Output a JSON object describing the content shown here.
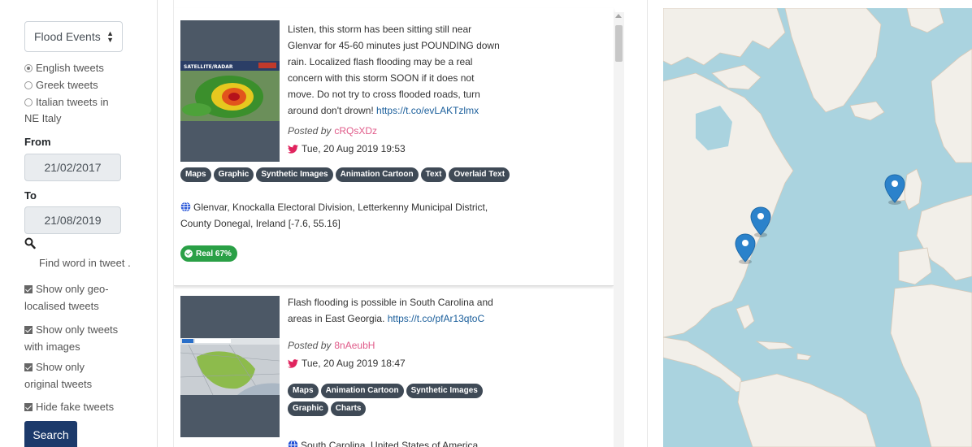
{
  "sidebar": {
    "event_select": "Flood Events",
    "languages": [
      {
        "label": "English tweets",
        "selected": true
      },
      {
        "label": "Greek tweets",
        "selected": false
      },
      {
        "label": "Italian tweets in",
        "label2": "NE Italy",
        "selected": false
      }
    ],
    "from_label": "From",
    "from_date": "21/02/2017",
    "to_label": "To",
    "to_date": "21/08/2019",
    "find_placeholder": "Find word in tweet .",
    "checkboxes": [
      {
        "line1": "Show only geo-",
        "line2": "localised tweets",
        "checked": true
      },
      {
        "line1": "Show only tweets",
        "line2": "with images",
        "checked": true
      },
      {
        "line1": "Show only",
        "line2": "original tweets",
        "checked": true
      },
      {
        "line1": "Hide fake tweets",
        "line2": "",
        "checked": true
      }
    ],
    "search_button": "Search"
  },
  "tweets": [
    {
      "lines": [
        "Listen, this storm has been sitting still near",
        "Glenvar for 45-60 minutes just POUNDING down",
        "rain. Localized flash flooding may be a real",
        "concern with this storm SOON if it does not",
        "move. Do not try to cross flooded roads, turn",
        "around don't drown!"
      ],
      "link": "https://t.co/evLAKTzlmx",
      "posted_label": "Posted by",
      "user": "cRQsXDz",
      "date": "Tue, 20 Aug 2019 19:53",
      "tags": [
        "Maps",
        "Graphic",
        "Synthetic Images",
        "Animation Cartoon",
        "Text",
        "Overlaid Text"
      ],
      "location_line1": "Glenvar, Knockalla Electoral Division, Letterkenny Municipal District,",
      "location_line2": "County Donegal, Ireland [-7.6, 55.16]",
      "badge": "Real 67%",
      "thumb_caption": "SATELLITE/RADAR"
    },
    {
      "lines": [
        "Flash flooding is possible in South Carolina and",
        "areas in East Georgia."
      ],
      "link": "https://t.co/pfAr13qtoC",
      "posted_label": "Posted by",
      "user": "8nAeubH",
      "date": "Tue, 20 Aug 2019 18:47",
      "tags": [
        "Maps",
        "Animation Cartoon",
        "Synthetic Images",
        "Graphic",
        "Charts"
      ],
      "location_line1": "South Carolina, United States of America"
    }
  ],
  "colors": {
    "accent": "#1c3a6b",
    "tag_bg": "#3f4a56",
    "real_badge": "#2aa046",
    "username": "#e05a89",
    "twitter": "#e0245e",
    "link": "#1a5e9b",
    "water": "#aad3df",
    "land": "#f2efe9",
    "marker": "#2b82cb"
  },
  "map": {
    "markers": [
      "Donegal, Ireland",
      "Canada / Great Lakes",
      "US East Coast"
    ]
  }
}
